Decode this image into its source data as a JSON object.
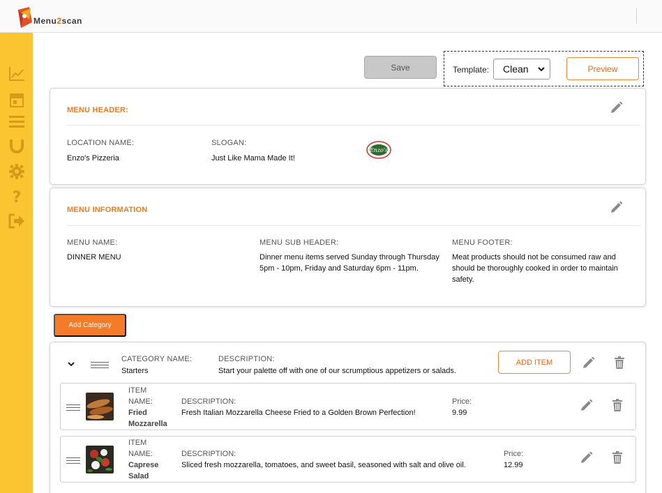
{
  "app": {
    "logo_prefix": "Menu",
    "logo_two": "2",
    "logo_suffix": "scan"
  },
  "toolbar": {
    "save_label": "Save",
    "template_label": "Template:",
    "template_value": "Clean",
    "preview_label": "Preview"
  },
  "sidebar": {
    "icons": [
      "chart-icon",
      "store-icon",
      "menu-list-icon",
      "magnet-icon",
      "gear-icon",
      "help-icon",
      "logout-icon"
    ]
  },
  "menu_header": {
    "title": "MENU HEADER:",
    "location_label": "LOCATION NAME:",
    "location_value": "Enzo's Pizzeria",
    "slogan_label": "SLOGAN:",
    "slogan_value": "Just Like Mama Made It!",
    "logo_text": "Enzo's"
  },
  "menu_info": {
    "title": "MENU INFORMATION",
    "name_label": "MENU NAME:",
    "name_value": "DINNER MENU",
    "subheader_label": "MENU SUB HEADER:",
    "subheader_value": "Dinner menu items served Sunday through Thursday 5pm - 10pm, Friday and Saturday 6pm - 11pm.",
    "footer_label": "MENU FOOTER:",
    "footer_value": "Meat products should not be consumed raw and should be thoroughly cooked in order to maintain safety."
  },
  "add_category_label": "Add Category",
  "category": {
    "name_label": "CATEGORY NAME:",
    "name_value": "Starters",
    "desc_label": "DESCRIPTION:",
    "desc_value": "Start your palette off with one of our scrumptious appetizers or salads.",
    "add_item_label": "ADD ITEM",
    "items": [
      {
        "item_label": "ITEM",
        "name_label": "NAME:",
        "name_line1": "Fried",
        "name_line2": "Mozzarella",
        "desc_label": "DESCRIPTION:",
        "desc_value": "Fresh Italian Mozzarella Cheese Fried to a Golden Brown Perfection!",
        "price_label": "Price:",
        "price_value": "9.99"
      },
      {
        "item_label": "ITEM",
        "name_label": "NAME:",
        "name_line1": "Caprese",
        "name_line2": "Salad",
        "desc_label": "DESCRIPTION:",
        "desc_value": "Sliced fresh mozzarella, tomatoes, and sweet basil, seasoned with salt and olive oil.",
        "price_label": "Price:",
        "price_value": "12.99"
      }
    ]
  },
  "colors": {
    "accent": "#f07b1d",
    "sidebar": "#fbc531",
    "icon_gray": "#8a8a8a"
  }
}
